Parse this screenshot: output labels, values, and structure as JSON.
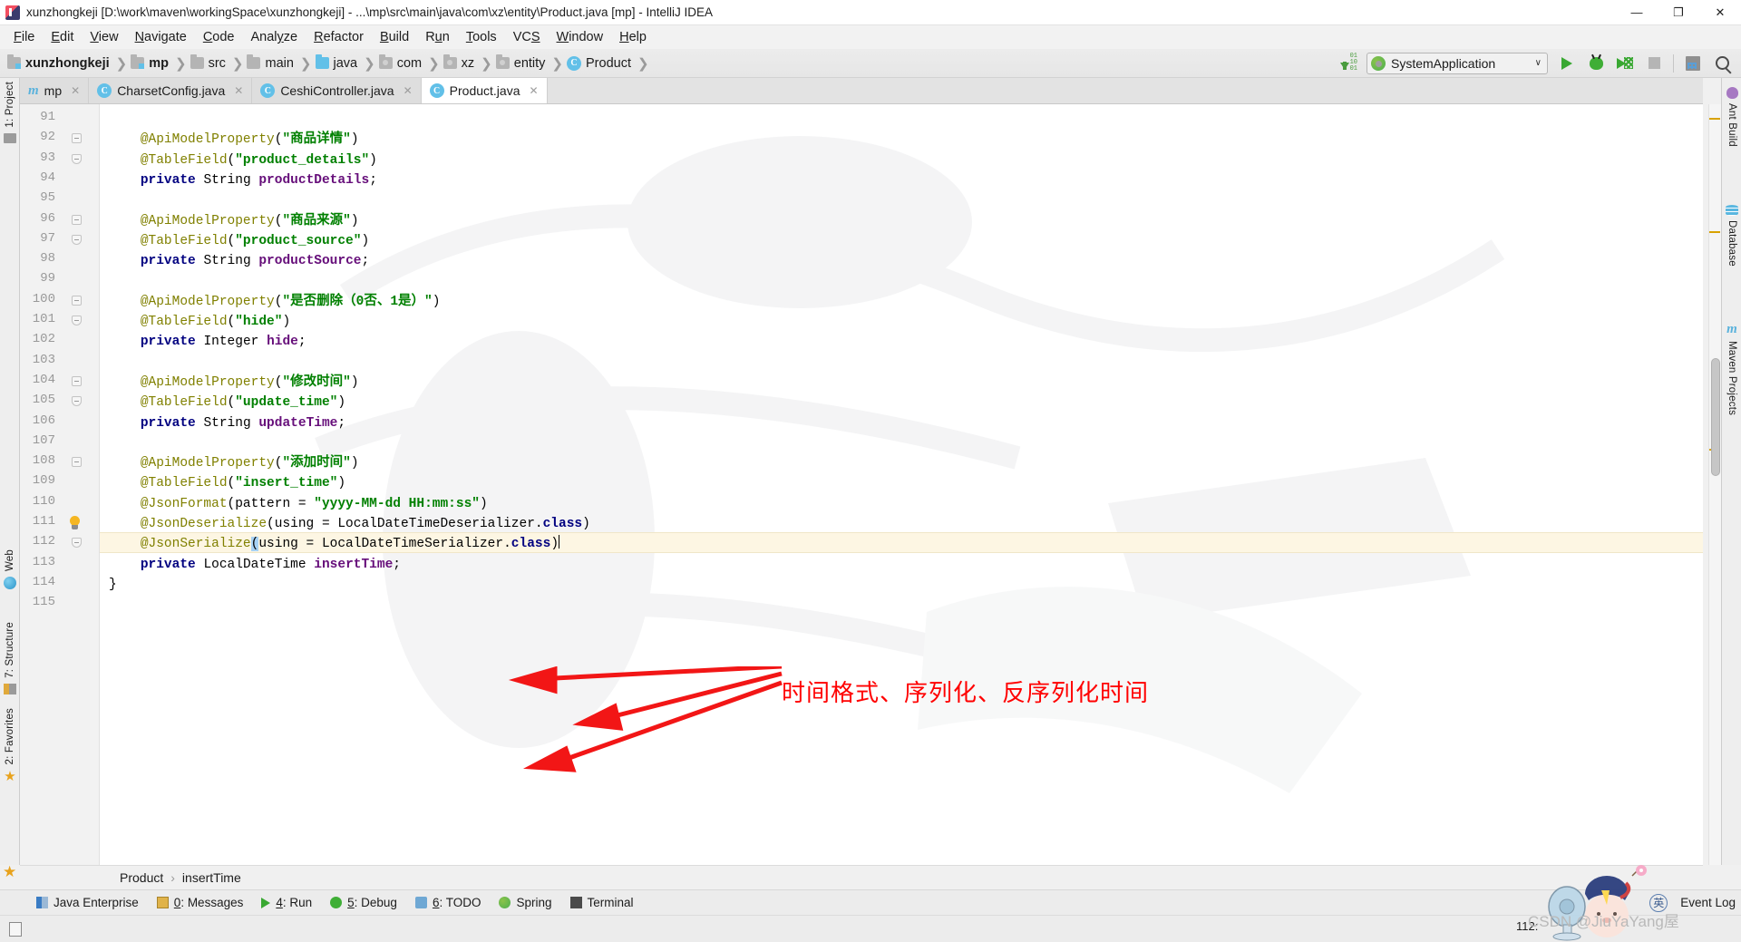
{
  "window": {
    "title": "xunzhongkeji [D:\\work\\maven\\workingSpace\\xunzhongkeji] - ...\\mp\\src\\main\\java\\com\\xz\\entity\\Product.java [mp] - IntelliJ IDEA",
    "minimize": "—",
    "maximize": "❐",
    "close": "✕"
  },
  "menubar": [
    {
      "pre": "",
      "mn": "F",
      "post": "ile"
    },
    {
      "pre": "",
      "mn": "E",
      "post": "dit"
    },
    {
      "pre": "",
      "mn": "V",
      "post": "iew"
    },
    {
      "pre": "",
      "mn": "N",
      "post": "avigate"
    },
    {
      "pre": "",
      "mn": "C",
      "post": "ode"
    },
    {
      "pre": "Anal",
      "mn": "y",
      "post": "ze"
    },
    {
      "pre": "",
      "mn": "R",
      "post": "efactor"
    },
    {
      "pre": "",
      "mn": "B",
      "post": "uild"
    },
    {
      "pre": "R",
      "mn": "u",
      "post": "n"
    },
    {
      "pre": "",
      "mn": "T",
      "post": "ools"
    },
    {
      "pre": "VC",
      "mn": "S",
      "post": ""
    },
    {
      "pre": "",
      "mn": "W",
      "post": "indow"
    },
    {
      "pre": "",
      "mn": "H",
      "post": "elp"
    }
  ],
  "breadcrumb": [
    {
      "label": "xunzhongkeji",
      "icon": "folder-module-icon",
      "bold": true
    },
    {
      "label": "mp",
      "icon": "folder-module-icon",
      "bold": true
    },
    {
      "label": "src",
      "icon": "folder-icon",
      "bold": false
    },
    {
      "label": "main",
      "icon": "folder-icon",
      "bold": false
    },
    {
      "label": "java",
      "icon": "folder-source-icon",
      "bold": false
    },
    {
      "label": "com",
      "icon": "folder-package-icon",
      "bold": false
    },
    {
      "label": "xz",
      "icon": "folder-package-icon",
      "bold": false
    },
    {
      "label": "entity",
      "icon": "folder-package-icon",
      "bold": false
    },
    {
      "label": "Product",
      "icon": "class-icon",
      "bold": false
    }
  ],
  "toolbar": {
    "run_config": "SystemApplication",
    "caret": "∨",
    "buttons": [
      "run-button",
      "debug-button",
      "run-with-coverage-button",
      "stop-button",
      "database-button",
      "search-everywhere-button"
    ]
  },
  "tabs": [
    {
      "label": "mp",
      "icon": "maven-icon",
      "active": false
    },
    {
      "label": "CharsetConfig.java",
      "icon": "class-icon",
      "active": false
    },
    {
      "label": "CeshiController.java",
      "icon": "class-icon",
      "active": false
    },
    {
      "label": "Product.java",
      "icon": "class-icon",
      "active": true
    }
  ],
  "left_tool_strip": [
    {
      "label": "1: Project",
      "mnemonic": "1",
      "icon": "project-icon"
    },
    {
      "label": "Web",
      "mnemonic": "",
      "icon": "web-icon"
    },
    {
      "label": "7: Structure",
      "mnemonic": "7",
      "icon": "structure-icon"
    },
    {
      "label": "2: Favorites",
      "mnemonic": "2",
      "icon": "favorites-star-icon"
    }
  ],
  "right_tool_strip": [
    {
      "label": "Ant Build",
      "icon": "ant-icon"
    },
    {
      "label": "Database",
      "icon": "database-icon"
    },
    {
      "label": "Maven Projects",
      "icon": "maven-icon"
    }
  ],
  "editor": {
    "first_line": 91,
    "highlighted_line": 112,
    "lines": [
      {
        "n": 91,
        "fold": "",
        "tokens": []
      },
      {
        "n": 92,
        "fold": "start",
        "tokens": [
          {
            "t": "@ApiModelProperty",
            "c": "ann"
          },
          {
            "t": "(",
            "c": "pln"
          },
          {
            "t": "\"商品详情\"",
            "c": "str"
          },
          {
            "t": ")",
            "c": "pln"
          }
        ]
      },
      {
        "n": 93,
        "fold": "end",
        "tokens": [
          {
            "t": "@TableField",
            "c": "ann"
          },
          {
            "t": "(",
            "c": "pln"
          },
          {
            "t": "\"product_details\"",
            "c": "str"
          },
          {
            "t": ")",
            "c": "pln"
          }
        ]
      },
      {
        "n": 94,
        "fold": "",
        "tokens": [
          {
            "t": "private ",
            "c": "k"
          },
          {
            "t": "String ",
            "c": "pln"
          },
          {
            "t": "productDetails",
            "c": "fld"
          },
          {
            "t": ";",
            "c": "pln"
          }
        ]
      },
      {
        "n": 95,
        "fold": "",
        "tokens": []
      },
      {
        "n": 96,
        "fold": "start",
        "tokens": [
          {
            "t": "@ApiModelProperty",
            "c": "ann"
          },
          {
            "t": "(",
            "c": "pln"
          },
          {
            "t": "\"商品来源\"",
            "c": "str"
          },
          {
            "t": ")",
            "c": "pln"
          }
        ]
      },
      {
        "n": 97,
        "fold": "end",
        "tokens": [
          {
            "t": "@TableField",
            "c": "ann"
          },
          {
            "t": "(",
            "c": "pln"
          },
          {
            "t": "\"product_source\"",
            "c": "str"
          },
          {
            "t": ")",
            "c": "pln"
          }
        ]
      },
      {
        "n": 98,
        "fold": "",
        "tokens": [
          {
            "t": "private ",
            "c": "k"
          },
          {
            "t": "String ",
            "c": "pln"
          },
          {
            "t": "productSource",
            "c": "fld"
          },
          {
            "t": ";",
            "c": "pln"
          }
        ]
      },
      {
        "n": 99,
        "fold": "",
        "tokens": []
      },
      {
        "n": 100,
        "fold": "start",
        "tokens": [
          {
            "t": "@ApiModelProperty",
            "c": "ann"
          },
          {
            "t": "(",
            "c": "pln"
          },
          {
            "t": "\"是否删除（0否、1是）\"",
            "c": "str"
          },
          {
            "t": ")",
            "c": "pln"
          }
        ]
      },
      {
        "n": 101,
        "fold": "end",
        "tokens": [
          {
            "t": "@TableField",
            "c": "ann"
          },
          {
            "t": "(",
            "c": "pln"
          },
          {
            "t": "\"hide\"",
            "c": "str"
          },
          {
            "t": ")",
            "c": "pln"
          }
        ]
      },
      {
        "n": 102,
        "fold": "",
        "tokens": [
          {
            "t": "private ",
            "c": "k"
          },
          {
            "t": "Integer ",
            "c": "pln"
          },
          {
            "t": "hide",
            "c": "fld"
          },
          {
            "t": ";",
            "c": "pln"
          }
        ]
      },
      {
        "n": 103,
        "fold": "",
        "tokens": []
      },
      {
        "n": 104,
        "fold": "start",
        "tokens": [
          {
            "t": "@ApiModelProperty",
            "c": "ann"
          },
          {
            "t": "(",
            "c": "pln"
          },
          {
            "t": "\"修改时间\"",
            "c": "str"
          },
          {
            "t": ")",
            "c": "pln"
          }
        ]
      },
      {
        "n": 105,
        "fold": "end",
        "tokens": [
          {
            "t": "@TableField",
            "c": "ann"
          },
          {
            "t": "(",
            "c": "pln"
          },
          {
            "t": "\"update_time\"",
            "c": "str"
          },
          {
            "t": ")",
            "c": "pln"
          }
        ]
      },
      {
        "n": 106,
        "fold": "",
        "tokens": [
          {
            "t": "private ",
            "c": "k"
          },
          {
            "t": "String ",
            "c": "pln"
          },
          {
            "t": "updateTime",
            "c": "fld"
          },
          {
            "t": ";",
            "c": "pln"
          }
        ]
      },
      {
        "n": 107,
        "fold": "",
        "tokens": []
      },
      {
        "n": 108,
        "fold": "start",
        "tokens": [
          {
            "t": "@ApiModelProperty",
            "c": "ann"
          },
          {
            "t": "(",
            "c": "pln"
          },
          {
            "t": "\"添加时间\"",
            "c": "str"
          },
          {
            "t": ")",
            "c": "pln"
          }
        ]
      },
      {
        "n": 109,
        "fold": "",
        "tokens": [
          {
            "t": "@TableField",
            "c": "ann"
          },
          {
            "t": "(",
            "c": "pln"
          },
          {
            "t": "\"insert_time\"",
            "c": "str"
          },
          {
            "t": ")",
            "c": "pln"
          }
        ]
      },
      {
        "n": 110,
        "fold": "",
        "tokens": [
          {
            "t": "@JsonFormat",
            "c": "ann"
          },
          {
            "t": "(pattern = ",
            "c": "pln"
          },
          {
            "t": "\"yyyy-MM-dd HH:mm:ss\"",
            "c": "str"
          },
          {
            "t": ")",
            "c": "pln"
          }
        ]
      },
      {
        "n": 111,
        "fold": "bulb",
        "tokens": [
          {
            "t": "@JsonDeserialize",
            "c": "ann"
          },
          {
            "t": "(using = LocalDateTimeDeserializer.",
            "c": "pln"
          },
          {
            "t": "class",
            "c": "k"
          },
          {
            "t": ")",
            "c": "pln"
          }
        ]
      },
      {
        "n": 112,
        "fold": "end",
        "tokens": [
          {
            "t": "@JsonSerialize",
            "c": "ann"
          },
          {
            "t": "(",
            "c": "sel"
          },
          {
            "t": "using = LocalDateTimeSerializer.",
            "c": "pln"
          },
          {
            "t": "class",
            "c": "k"
          },
          {
            "t": ")",
            "c": "pln"
          }
        ]
      },
      {
        "n": 113,
        "fold": "",
        "tokens": [
          {
            "t": "private ",
            "c": "k"
          },
          {
            "t": "LocalDateTime ",
            "c": "pln"
          },
          {
            "t": "insertTime",
            "c": "fld"
          },
          {
            "t": ";",
            "c": "pln"
          }
        ]
      },
      {
        "n": 114,
        "fold": "",
        "tokens": [
          {
            "t": "}",
            "c": "pln"
          }
        ]
      },
      {
        "n": 115,
        "fold": "",
        "tokens": []
      }
    ]
  },
  "annotation": {
    "text": "时间格式、序列化、反序列化时间",
    "color": "#ff0000",
    "arrow_count": 3
  },
  "bottom_breadcrumb": {
    "class": "Product",
    "separator": "›",
    "member": "insertTime"
  },
  "tool_windows": [
    {
      "label_pre": "Java Enterprise",
      "mn": "",
      "label_post": "",
      "icon": "java-enterprise-icon"
    },
    {
      "label_pre": "",
      "mn": "0",
      "label_post": ": Messages",
      "icon": "messages-icon"
    },
    {
      "label_pre": "",
      "mn": "4",
      "label_post": ": Run",
      "icon": "run-icon"
    },
    {
      "label_pre": "",
      "mn": "5",
      "label_post": ": Debug",
      "icon": "debug-icon"
    },
    {
      "label_pre": "",
      "mn": "6",
      "label_post": ": TODO",
      "icon": "todo-icon"
    },
    {
      "label_pre": "Spring",
      "mn": "",
      "label_post": "",
      "icon": "spring-icon"
    },
    {
      "label_pre": "Terminal",
      "mn": "",
      "label_post": "",
      "icon": "terminal-icon"
    }
  ],
  "status_right": {
    "position": "112:",
    "event_log": "Event Log",
    "ime": "英"
  },
  "watermark": "CSDN @JiuYaYang屋"
}
